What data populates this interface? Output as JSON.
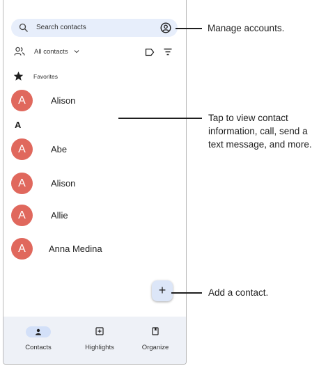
{
  "search": {
    "placeholder": "Search contacts",
    "icon": "search-icon",
    "account_icon": "account-circle-icon"
  },
  "filter": {
    "label": "All contacts",
    "people_icon": "people-icon",
    "chevron_icon": "chevron-down-icon",
    "label_icon": "label-icon",
    "sort_icon": "sort-icon"
  },
  "favorites": {
    "header": "Favorites",
    "contacts": [
      {
        "initial": "A",
        "name": "Alison"
      }
    ]
  },
  "sections": [
    {
      "letter": "A",
      "contacts": [
        {
          "initial": "A",
          "name": "Abe"
        },
        {
          "initial": "A",
          "name": "Alison"
        },
        {
          "initial": "A",
          "name": "Allie"
        },
        {
          "initial": "A",
          "name": "Anna Medina"
        }
      ]
    }
  ],
  "fab": {
    "label": "+"
  },
  "nav": [
    {
      "label": "Contacts",
      "icon": "person-icon",
      "selected": true
    },
    {
      "label": "Highlights",
      "icon": "highlights-icon",
      "selected": false
    },
    {
      "label": "Organize",
      "icon": "bookmark-icon",
      "selected": false
    }
  ],
  "callouts": {
    "manage": "Manage accounts.",
    "tap_line1": "Tap to view contact",
    "tap_line2": "information, call, send a",
    "tap_line3": "text message, and more.",
    "add": "Add a contact."
  },
  "colors": {
    "avatar": "#e0685d",
    "search_bg": "#e7eefb",
    "nav_bg": "#eef1f7",
    "nav_pill": "#d3e0f8"
  }
}
